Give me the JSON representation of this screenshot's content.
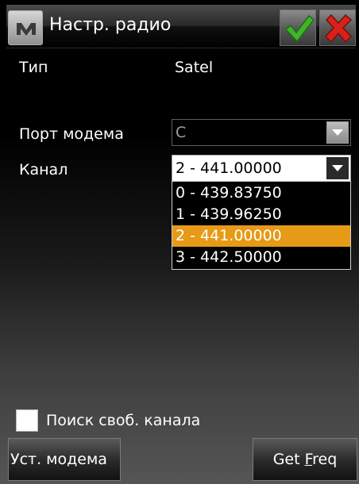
{
  "window": {
    "title": "Настр. радио",
    "icon": "m-logo-icon",
    "ok_icon": "checkmark-icon",
    "cancel_icon": "close-x-icon"
  },
  "form": {
    "type_label": "Тип",
    "type_value": "Satel",
    "port_label": "Порт модема",
    "port_value": "C",
    "channel_label": "Канал",
    "channel_value": "2 - 441.00000",
    "channel_options": [
      "0 - 439.83750",
      "1 - 439.96250",
      "2 - 441.00000",
      "3 - 442.50000"
    ],
    "selected_option": "2 - 441.00000",
    "free_channel_label": "Поиск своб. канала",
    "free_channel_checked": false
  },
  "buttons": {
    "set_modem": "Уст. модема",
    "get_freq_prefix": "Get ",
    "get_freq_underlined": "F",
    "get_freq_suffix": "req"
  },
  "colors": {
    "highlight": "#e69a16",
    "ok_green": "#3fb52a",
    "cancel_red": "#d8211b"
  }
}
